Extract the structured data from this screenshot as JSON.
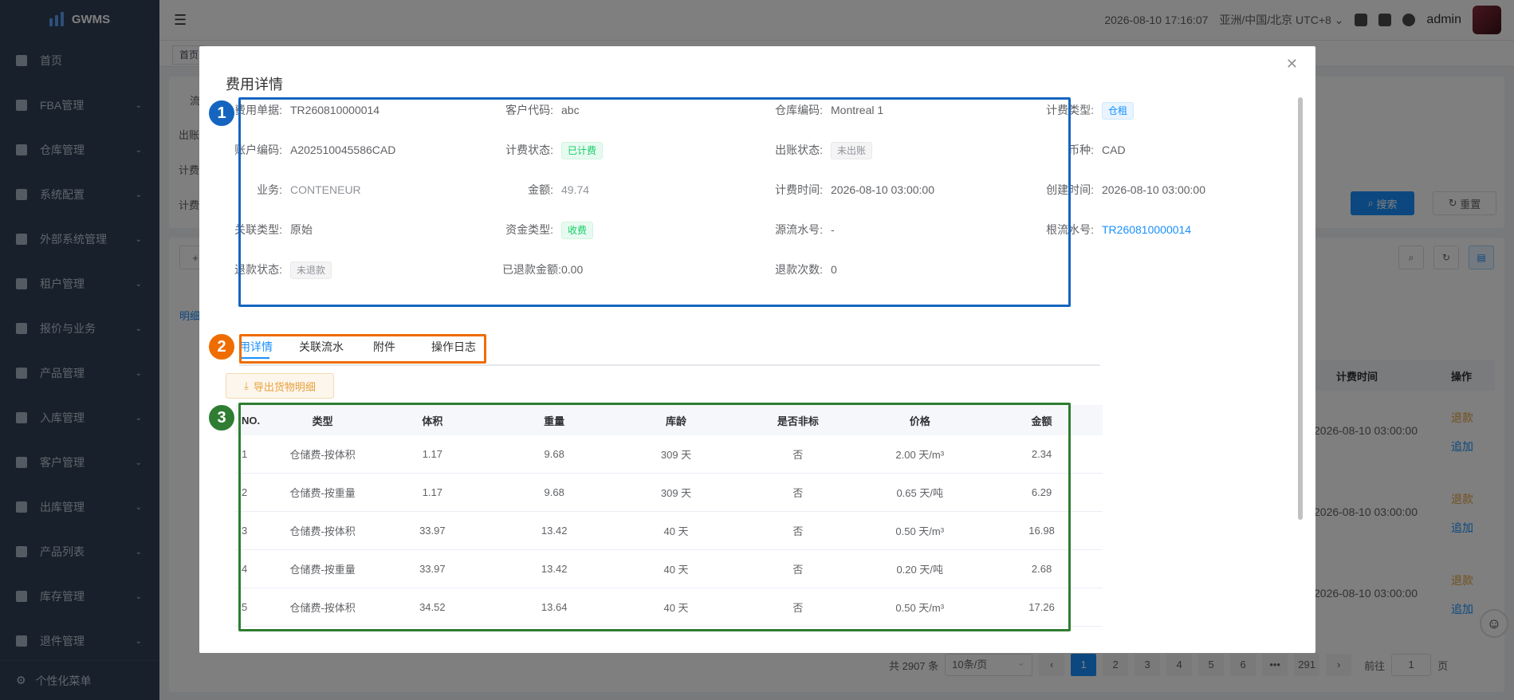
{
  "app": {
    "name": "GWMS"
  },
  "sidebar": {
    "items": [
      {
        "label": "首页",
        "icon": "dashboard-icon",
        "chevron": false
      },
      {
        "label": "FBA管理",
        "icon": "fba-icon",
        "chevron": true
      },
      {
        "label": "仓库管理",
        "icon": "warehouse-icon",
        "chevron": true
      },
      {
        "label": "系统配置",
        "icon": "settings-icon",
        "chevron": true
      },
      {
        "label": "外部系统管理",
        "icon": "grid-icon",
        "chevron": true
      },
      {
        "label": "租户管理",
        "icon": "chart-icon",
        "chevron": true
      },
      {
        "label": "报价与业务",
        "icon": "quote-icon",
        "chevron": true
      },
      {
        "label": "产品管理",
        "icon": "cart-icon",
        "chevron": true
      },
      {
        "label": "入库管理",
        "icon": "home-icon",
        "chevron": true
      },
      {
        "label": "客户管理",
        "icon": "user-icon",
        "chevron": true
      },
      {
        "label": "出库管理",
        "icon": "grid-icon",
        "chevron": true
      },
      {
        "label": "产品列表",
        "icon": "book-icon",
        "chevron": true
      },
      {
        "label": "库存管理",
        "icon": "table-icon",
        "chevron": true
      },
      {
        "label": "退件管理",
        "icon": "return-icon",
        "chevron": true
      }
    ],
    "footer": "个性化菜单"
  },
  "header": {
    "datetime": "2026-08-10 17:16:07",
    "timezone": "亚洲/中国/北京 UTC+8",
    "user": "admin"
  },
  "tags": {
    "home": "首页"
  },
  "background": {
    "search_btn": "搜索",
    "reset_btn": "重置",
    "left_labels": [
      "流",
      "出账",
      "计费",
      "计费"
    ],
    "add_btn": "+",
    "detail_tab": "明细",
    "col_time": "计费时间",
    "col_action": "操作",
    "rows": [
      {
        "time": "2026-08-10 03:00:00",
        "refund": "退款",
        "add": "追加"
      },
      {
        "time": "2026-08-10 03:00:00",
        "refund": "退款",
        "add": "追加"
      },
      {
        "time": "2026-08-10 03:00:00",
        "refund": "退款",
        "add": "追加"
      }
    ],
    "pagination": {
      "total": "共 2907 条",
      "page_size": "10条/页",
      "pages": [
        "1",
        "2",
        "3",
        "4",
        "5",
        "6",
        "•••",
        "291"
      ],
      "goto_label": "前往",
      "goto_value": "1",
      "page_unit": "页"
    }
  },
  "modal": {
    "title": "费用详情",
    "fields": {
      "fee_no_label": "费用单据:",
      "fee_no": "TR260810000014",
      "customer_code_label": "客户代码:",
      "customer_code": "abc",
      "warehouse_code_label": "仓库编码:",
      "warehouse_code": "Montreal 1",
      "billing_type_label": "计费类型:",
      "billing_type": "仓租",
      "account_code_label": "账户编码:",
      "account_code": "A202510045586CAD",
      "billing_status_label": "计费状态:",
      "billing_status": "已计费",
      "settle_status_label": "出账状态:",
      "settle_status": "未出账",
      "currency_label": "币种:",
      "currency": "CAD",
      "business_label": "业务:",
      "business": "CONTENEUR",
      "amount_label": "金额:",
      "amount": "49.74",
      "billing_time_label": "计费时间:",
      "billing_time": "2026-08-10 03:00:00",
      "created_time_label": "创建时间:",
      "created_time": "2026-08-10 03:00:00",
      "relation_type_label": "关联类型:",
      "relation_type": "原始",
      "fund_type_label": "资金类型:",
      "fund_type": "收费",
      "source_serial_label": "源流水号:",
      "source_serial": "-",
      "root_serial_label": "根流水号:",
      "root_serial": "TR260810000014",
      "refund_status_label": "退款状态:",
      "refund_status": "未退款",
      "refunded_amount_label": "已退款金额:",
      "refunded_amount": "0.00",
      "refund_count_label": "退款次数:",
      "refund_count": "0"
    },
    "tabs": [
      "用详情",
      "关联流水",
      "附件",
      "操作日志"
    ],
    "export_btn": "导出货物明细",
    "table": {
      "headers": [
        "NO.",
        "类型",
        "体积",
        "重量",
        "库龄",
        "是否非标",
        "价格",
        "金额"
      ],
      "rows": [
        [
          "1",
          "仓储费-按体积",
          "1.17",
          "9.68",
          "309 天",
          "否",
          "2.00 天/m³",
          "2.34"
        ],
        [
          "2",
          "仓储费-按重量",
          "1.17",
          "9.68",
          "309 天",
          "否",
          "0.65 天/吨",
          "6.29"
        ],
        [
          "3",
          "仓储费-按体积",
          "33.97",
          "13.42",
          "40 天",
          "否",
          "0.50 天/m³",
          "16.98"
        ],
        [
          "4",
          "仓储费-按重量",
          "33.97",
          "13.42",
          "40 天",
          "否",
          "0.20 天/吨",
          "2.68"
        ],
        [
          "5",
          "仓储费-按体积",
          "34.52",
          "13.64",
          "40 天",
          "否",
          "0.50 天/m³",
          "17.26"
        ]
      ]
    }
  },
  "annotations": [
    "1",
    "2",
    "3"
  ],
  "colors": {
    "primary": "#1890ff",
    "sidebar": "#304156",
    "box_blue": "#1565c0",
    "box_orange": "#ef6c00",
    "box_green": "#2e7d32"
  }
}
